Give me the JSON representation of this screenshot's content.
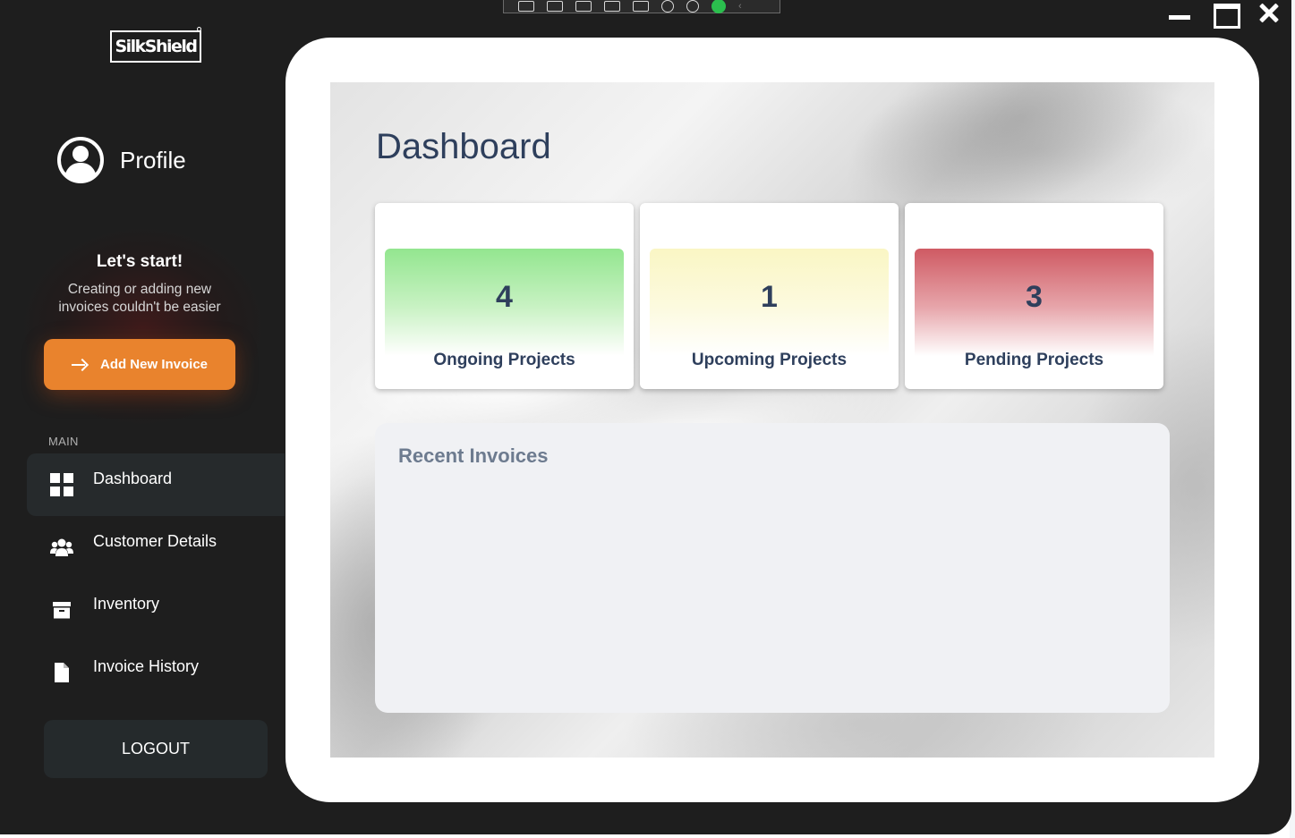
{
  "sidebar": {
    "logo_text": "SilkShield",
    "profile_label": "Profile",
    "promo": {
      "title": "Let's start!",
      "subtitle_line1": "Creating or adding new",
      "subtitle_line2": "invoices couldn't be easier"
    },
    "add_invoice_label": "Add New Invoice",
    "section_label": "MAIN",
    "nav": [
      {
        "label": "Dashboard",
        "icon": "grid-icon",
        "active": true
      },
      {
        "label": "Customer Details",
        "icon": "users-icon",
        "active": false
      },
      {
        "label": "Inventory",
        "icon": "archive-box-icon",
        "active": false
      },
      {
        "label": "Invoice History",
        "icon": "file-icon",
        "active": false
      }
    ],
    "logout_label": "LOGOUT"
  },
  "main": {
    "title": "Dashboard",
    "stats": [
      {
        "value": "4",
        "label": "Ongoing Projects",
        "color": "#93e68f"
      },
      {
        "value": "1",
        "label": "Upcoming Projects",
        "color": "#faf6c4"
      },
      {
        "value": "3",
        "label": "Pending Projects",
        "color": "#cf5a63"
      }
    ],
    "recent_invoices_title": "Recent Invoices"
  },
  "colors": {
    "sidebar_bg": "#1e1e1e",
    "accent_orange": "#e9832d",
    "heading_navy": "#2e3f5c",
    "recent_title": "#6d7b8f"
  }
}
